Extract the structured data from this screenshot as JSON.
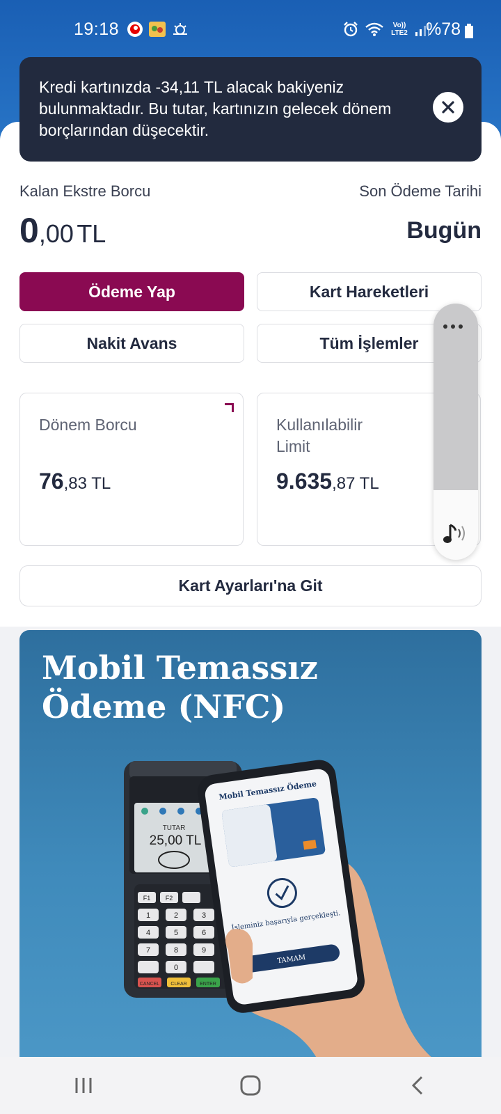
{
  "status_bar": {
    "time": "19:18",
    "network": "Vo)) LTE2",
    "battery": "%78"
  },
  "toast": {
    "message": "Kredi kartınızda -34,11 TL alacak bakiyeniz bulunmaktadır. Bu tutar, kartınızın gelecek dönem borçlarından düşecektir.",
    "close_icon": "close-icon"
  },
  "statement": {
    "remaining_label": "Kalan Ekstre Borcu",
    "remaining_int": "0",
    "remaining_dec": ",00",
    "remaining_currency": "TL",
    "due_label": "Son Ödeme Tarihi",
    "due_value": "Bugün"
  },
  "actions": {
    "pay": "Ödeme Yap",
    "transactions": "Kart Hareketleri",
    "cash_advance": "Nakit Avans",
    "all_operations": "Tüm İşlemler"
  },
  "cards": {
    "period_debt_label": "Dönem Borcu",
    "period_debt_int": "76",
    "period_debt_dec": ",83 TL",
    "limit_label": "Kullanılabilir Limit",
    "limit_int": "9.635",
    "limit_dec": ",87 TL"
  },
  "settings_button": "Kart Ayarları'na Git",
  "banner": {
    "title": "Mobil Temassız Ödeme (NFC)",
    "pos_amount_label": "TUTAR",
    "pos_amount": "25,00 TL",
    "phone_title": "Mobil Temassız Ödeme",
    "phone_success": "İşleminiz başarıyla gerçekleşti.",
    "phone_button": "TAMAM",
    "pos_keys": [
      "1",
      "2",
      "3",
      "4",
      "5",
      "6",
      "7",
      "8",
      "9",
      "0"
    ],
    "pos_func_keys": [
      "F1",
      "F2",
      "CANCEL",
      "CLEAR",
      "ENTER"
    ]
  },
  "colors": {
    "brand_primary": "#8a0a52",
    "header_blue": "#1a5fb4",
    "toast_bg": "#222a3e",
    "text_dark": "#232a3f"
  }
}
